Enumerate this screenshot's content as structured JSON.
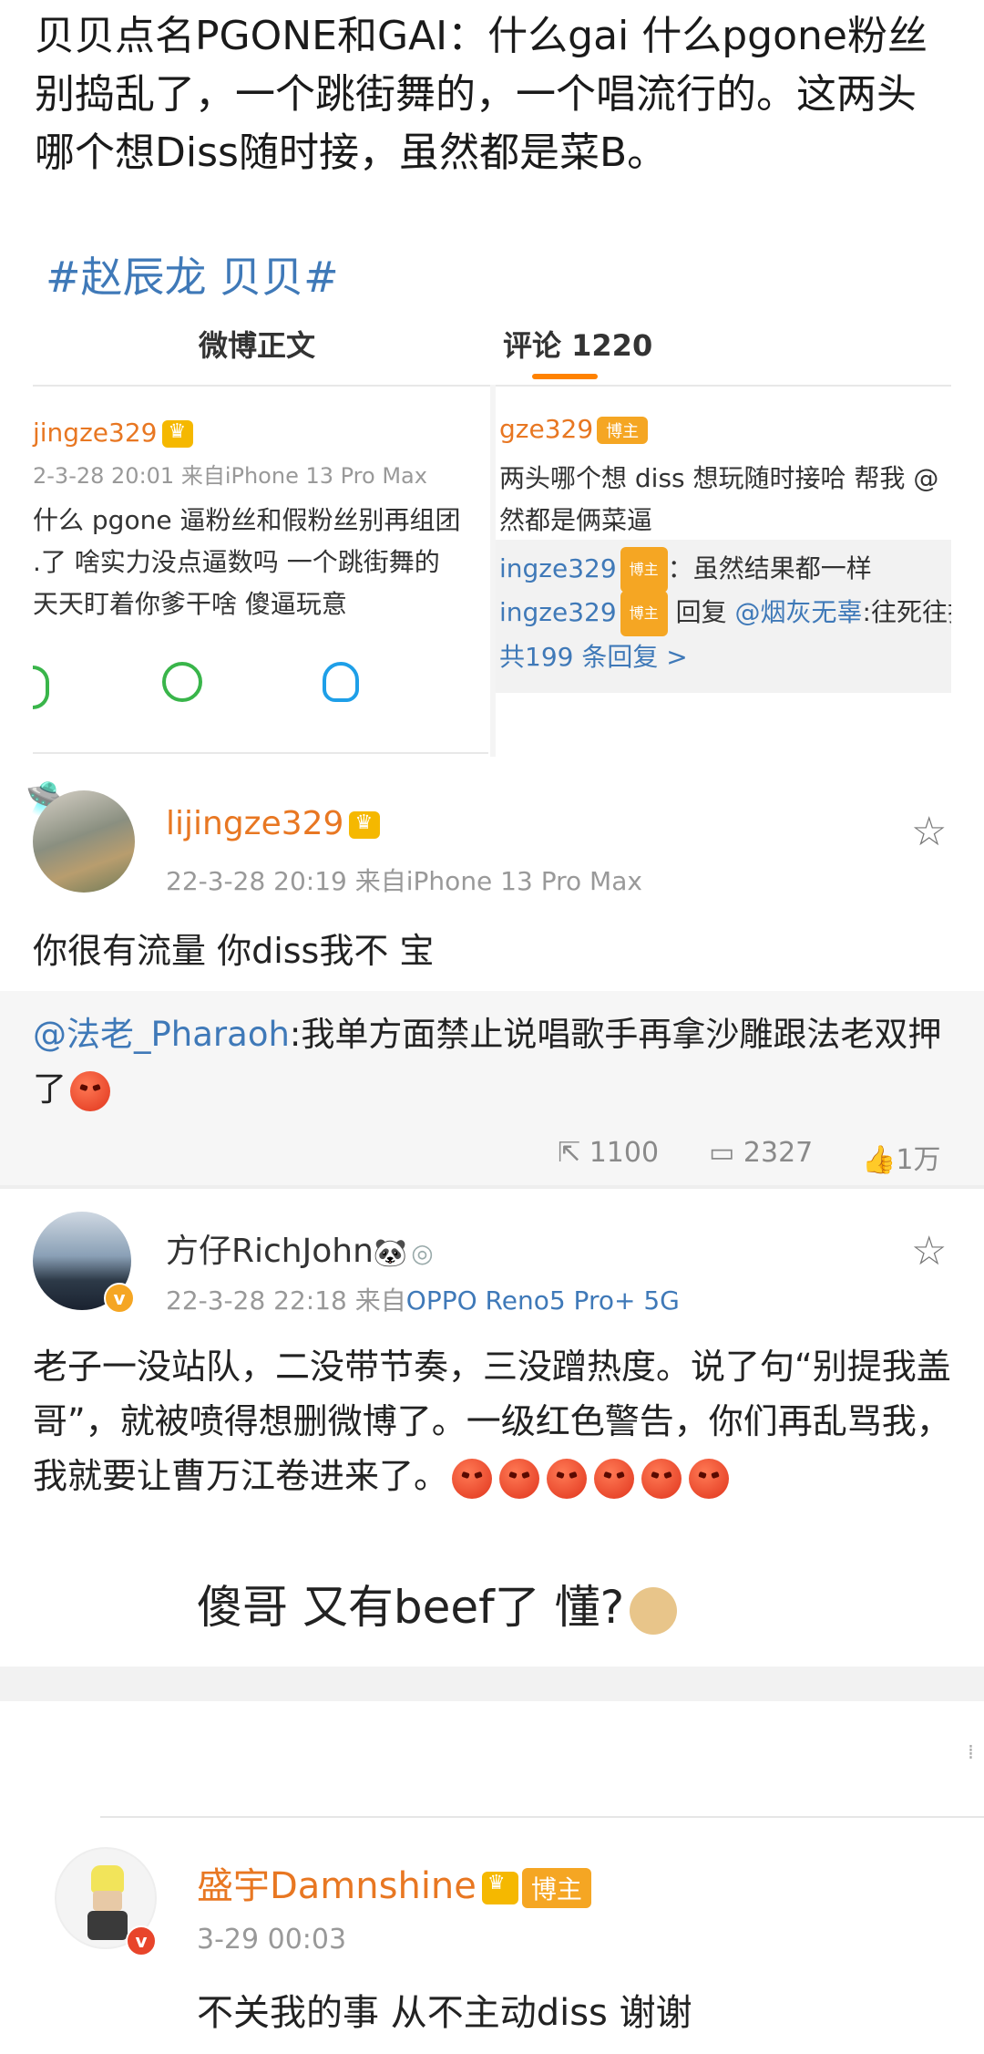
{
  "intro": {
    "text": "贝贝点名PGONE和GAI：什么gai 什么pgone粉丝别捣乱了，一个跳街舞的，一个唱流行的。这两头哪个想Diss随时接，虽然都是菜B。",
    "hashtag": "#赵辰龙 贝贝#"
  },
  "embedded": {
    "tabs": [
      {
        "label": "微博正文"
      },
      {
        "label": "评论 1220"
      }
    ],
    "left_post": {
      "user": "jingze329",
      "meta": "2-3-28 20:01  来自iPhone 13 Pro Max",
      "lines": [
        "什么 pgone 逼粉丝和假粉丝别再组团",
        ".了 啥实力没点逼数吗 一个跳街舞的",
        "天天盯着你爹干啥 傻逼玩意"
      ]
    },
    "right_post": {
      "user": "gze329",
      "badge": "博主",
      "lines": [
        "两头哪个想 diss 想玩随时接哈 帮我 @",
        "然都是俩菜逼"
      ],
      "replies": [
        {
          "user": "ingze329",
          "badge": "博主",
          "text": "：虽然结果都一样"
        },
        {
          "user": "ingze329",
          "badge": "博主",
          "text": " 回复 ",
          "mention": "@烟灰无辜",
          "text2": ":往死往打"
        }
      ],
      "more": "共199 条回复 >"
    }
  },
  "comments": [
    {
      "user": "lijingze329",
      "meta": "22-3-28 20:19  来自iPhone 13 Pro Max",
      "body": "你很有流量 你diss我不 宝",
      "quote": {
        "mention": "@法老_Pharaoh",
        "text": ":我单方面禁止说唱歌手再拿沙雕跟法老双押了"
      },
      "stats": {
        "repost": "1100",
        "comment": "2327",
        "like": "1万"
      }
    },
    {
      "user": "方仔RichJohn",
      "meta_date": "22-3-28 22:18  来自",
      "meta_device": "OPPO Reno5 Pro+ 5G",
      "body": "老子一没站队，二没带节奏，三没蹭热度。说了句“别提我盖哥”，就被喷得想删微博了。一级红色警告，你们再乱骂我，我就要让曹万江卷进来了。",
      "caption": "傻哥 又有beef了 懂?"
    },
    {
      "user": "盛宇Damnshine",
      "badge": "博主",
      "meta": "3-29 00:03",
      "body": "不关我的事 从不主动diss 谢谢"
    }
  ],
  "colors": {
    "accent_orange": "#ff8200",
    "link_blue": "#3f79b8",
    "vip_orange": "#e87722"
  }
}
